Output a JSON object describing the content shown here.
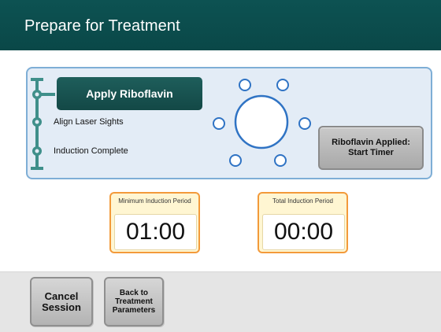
{
  "header": {
    "title": "Prepare for Treatment"
  },
  "steps": {
    "items": [
      {
        "label": "Apply Riboflavin",
        "state": "active"
      },
      {
        "label": "Align Laser Sights",
        "state": "pending"
      },
      {
        "label": "Induction Complete",
        "state": "pending"
      }
    ]
  },
  "start_timer_button": {
    "line1": "Riboflavin Applied:",
    "line2": "Start Timer"
  },
  "timers": {
    "minimum": {
      "label": "Minimum Induction Period",
      "value": "01:00"
    },
    "total": {
      "label": "Total Induction Period",
      "value": "00:00"
    }
  },
  "footer": {
    "cancel_line1": "Cancel",
    "cancel_line2": "Session",
    "back_line1": "Back to",
    "back_line2": "Treatment",
    "back_line3": "Parameters"
  },
  "icons": {
    "step_progress": "step-progress-rail-icon",
    "alignment": "eye-alignment-target-icon"
  },
  "colors": {
    "header_bg": "#0d5252",
    "active_step_bg": "#1e5e5b",
    "rail": "#3f8f8a",
    "panel_bg": "#e3ecf6",
    "panel_border": "#7eaed6",
    "target_blue": "#2f73c4",
    "timer_border": "#f39a3a",
    "timer_bg": "#fff6d2",
    "footer_bg": "#e5e5e5"
  }
}
